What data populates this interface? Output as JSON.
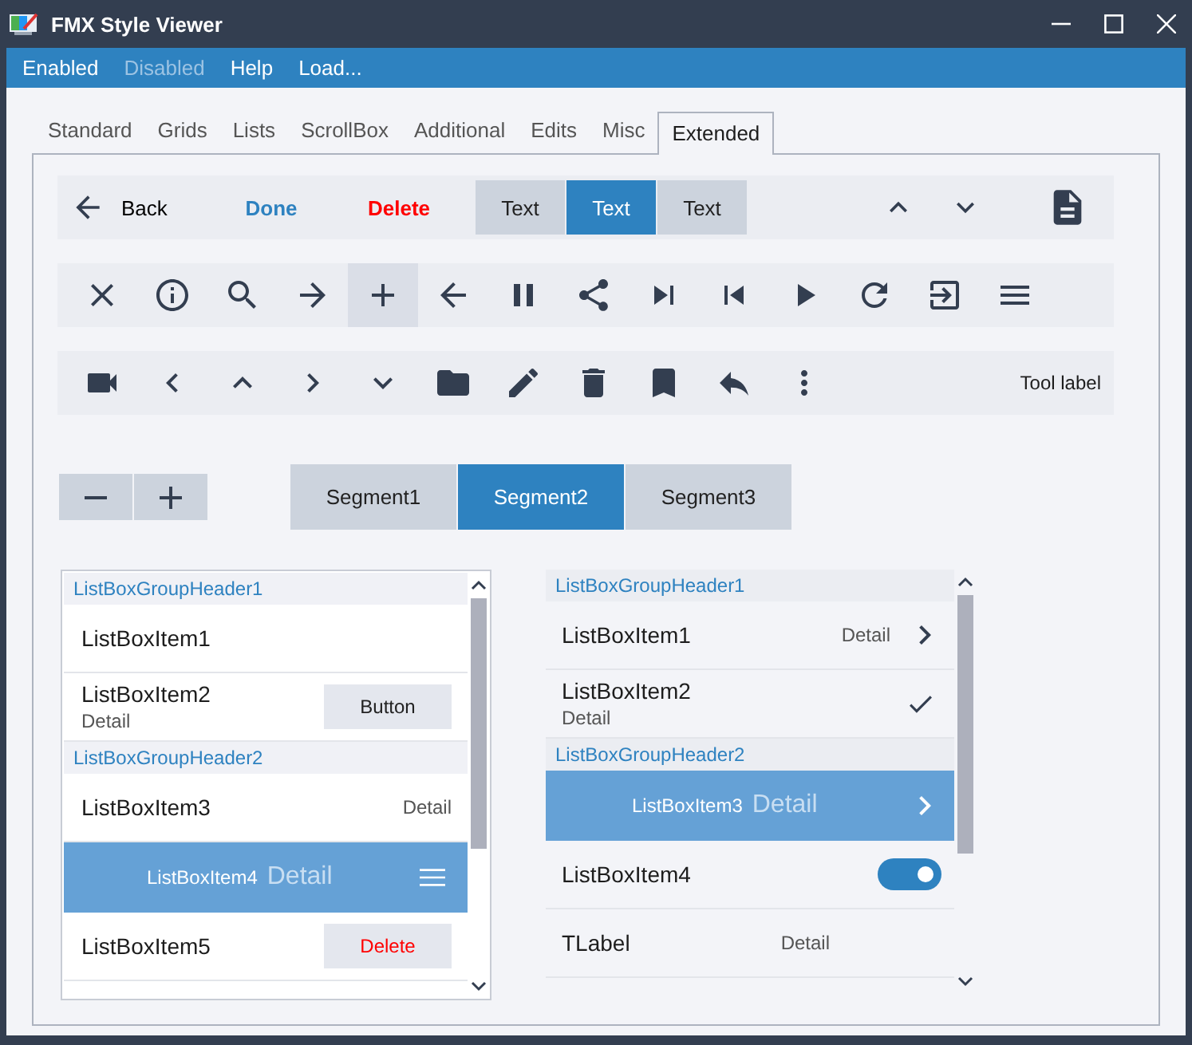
{
  "window": {
    "title": "FMX Style Viewer"
  },
  "menu": [
    {
      "label": "Enabled",
      "disabled": false
    },
    {
      "label": "Disabled",
      "disabled": true
    },
    {
      "label": "Help",
      "disabled": false
    },
    {
      "label": "Load...",
      "disabled": false
    }
  ],
  "tabs": [
    {
      "label": "Standard",
      "selected": false
    },
    {
      "label": "Grids",
      "selected": false
    },
    {
      "label": "Lists",
      "selected": false
    },
    {
      "label": "ScrollBox",
      "selected": false
    },
    {
      "label": "Additional",
      "selected": false
    },
    {
      "label": "Edits",
      "selected": false
    },
    {
      "label": "Misc",
      "selected": false
    },
    {
      "label": "Extended",
      "selected": true
    }
  ],
  "toolbar_top": {
    "back": "Back",
    "done": "Done",
    "delete": "Delete",
    "segments": [
      {
        "label": "Text",
        "selected": false
      },
      {
        "label": "Text",
        "selected": true
      },
      {
        "label": "Text",
        "selected": false
      }
    ]
  },
  "toolbar_icons": [
    {
      "selected": false
    },
    {
      "selected": false
    },
    {
      "selected": false
    },
    {
      "selected": false
    },
    {
      "selected": true
    },
    {
      "selected": false
    },
    {
      "selected": false
    },
    {
      "selected": false
    },
    {
      "selected": false
    },
    {
      "selected": false
    },
    {
      "selected": false
    },
    {
      "selected": false
    },
    {
      "selected": false
    },
    {
      "selected": false
    }
  ],
  "toolbar_bottom": {
    "label": "Tool label"
  },
  "segments": [
    {
      "label": "Segment1",
      "selected": false
    },
    {
      "label": "Segment2",
      "selected": true
    },
    {
      "label": "Segment3",
      "selected": false
    }
  ],
  "left_list": [
    {
      "kind": "header",
      "text": "ListBoxGroupHeader1"
    },
    {
      "kind": "plain",
      "text": "ListBoxItem1",
      "selected": false
    },
    {
      "kind": "subtitlebutton",
      "text": "ListBoxItem2",
      "detail": "Detail",
      "action": "Button",
      "selected": false
    },
    {
      "kind": "header",
      "text": "ListBoxGroupHeader2"
    },
    {
      "kind": "rightdetail",
      "text": "ListBoxItem3",
      "detail": "Detail",
      "selected": false
    },
    {
      "kind": "inlinemenu",
      "text": "ListBoxItem4",
      "detail": "Detail",
      "selected": true
    },
    {
      "kind": "deletebutton",
      "text": "ListBoxItem5",
      "action": "Delete",
      "selected": false
    }
  ],
  "right_list": [
    {
      "kind": "header",
      "text": "ListBoxGroupHeader1"
    },
    {
      "kind": "detailchevron",
      "text": "ListBoxItem1",
      "detail": "Detail",
      "selected": false
    },
    {
      "kind": "subtitlecheck",
      "text": "ListBoxItem2",
      "detail": "Detail",
      "checked": true,
      "selected": false
    },
    {
      "kind": "header",
      "text": "ListBoxGroupHeader2"
    },
    {
      "kind": "inlinechevron",
      "text": "ListBoxItem3",
      "detail": "Detail",
      "selected": true
    },
    {
      "kind": "switch",
      "text": "ListBoxItem4",
      "on": true,
      "selected": false
    },
    {
      "kind": "label",
      "text": "TLabel",
      "detail": "Detail",
      "selected": false
    }
  ]
}
